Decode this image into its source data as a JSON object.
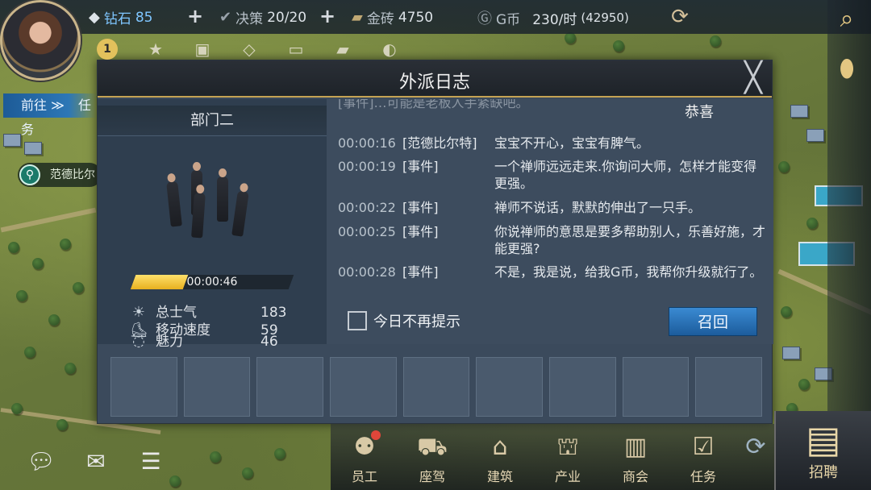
{
  "hud": {
    "diamond_label": "钻石",
    "diamond_value": "85",
    "decision_label": "决策",
    "decision_value": "20/20",
    "gold_label": "金砖",
    "gold_value": "4750",
    "gcoin_label": "G币",
    "gcoin_rate": "230/时",
    "gcoin_total": "(42950)",
    "plus": "+",
    "level_badge": "1"
  },
  "map": {
    "goto_label": "前往 ≫",
    "task_label": "任务",
    "location_label": "范德比尔"
  },
  "modal": {
    "title": "外派日志",
    "dept_name": "部门二",
    "progress_time": "00:00:46",
    "progress_fraction": 0.33,
    "stats": [
      {
        "label": "总士气",
        "value": "183"
      },
      {
        "label": "魅力",
        "value": "46"
      },
      {
        "label": "移动速度",
        "value": "59"
      }
    ],
    "congrats": "恭喜",
    "faded_text": "[事件]…可能是老板人手紧缺吧。",
    "log": [
      {
        "time": "00:00:16",
        "who": "[范德比尔特]",
        "msg": "宝宝不开心，宝宝有脾气。"
      },
      {
        "time": "00:00:19",
        "who": "[事件]",
        "msg": "一个禅师远远走来.你询问大师，怎样才能变得更强。"
      },
      {
        "time": "00:00:22",
        "who": "[事件]",
        "msg": "禅师不说话，默默的伸出了一只手。"
      },
      {
        "time": "00:00:25",
        "who": "[事件]",
        "msg": "你说禅师的意思是要多帮助别人，乐善好施，才能更强?"
      },
      {
        "time": "00:00:28",
        "who": "[事件]",
        "msg": "不是，我是说，给我G币，我帮你升级就行了。"
      }
    ],
    "dont_show_label": "今日不再提示",
    "recall_label": "召回",
    "close_symbol": "╳"
  },
  "nav": {
    "items": [
      {
        "label": "员工",
        "icon": "staff-icon",
        "dot": true
      },
      {
        "label": "座驾",
        "icon": "car-icon",
        "dot": false
      },
      {
        "label": "建筑",
        "icon": "factory-icon",
        "dot": false
      },
      {
        "label": "产业",
        "icon": "shop-icon",
        "dot": false
      },
      {
        "label": "商会",
        "icon": "building-icon",
        "dot": false
      },
      {
        "label": "任务",
        "icon": "task-icon",
        "dot": false
      }
    ],
    "recruit_label": "招聘"
  },
  "colors": {
    "accent_gold": "#c5a253",
    "recall_blue": "#2d77b6",
    "progress_yellow": "#f0c030",
    "diamond_blue": "#7fc6ff"
  }
}
